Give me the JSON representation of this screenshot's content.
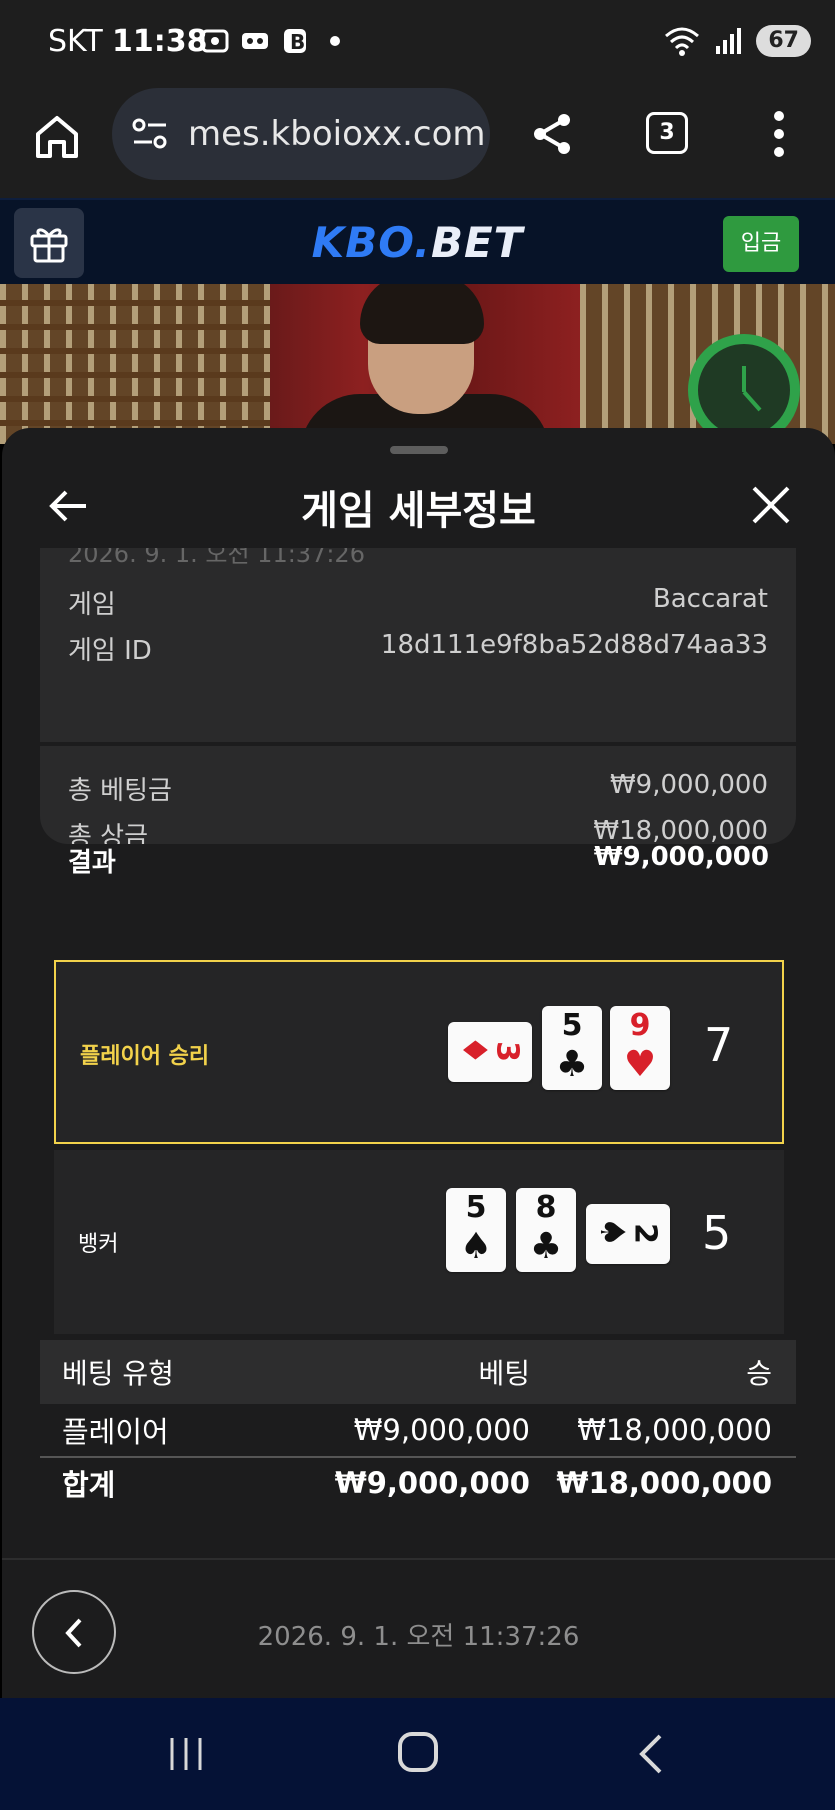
{
  "status_bar": {
    "carrier": "SKT",
    "time": "11:38",
    "battery": "67"
  },
  "browser": {
    "url": "mes.kboioxx.com",
    "tab_count": "3"
  },
  "site_header": {
    "logo_kbo": "KBO",
    "logo_dot": ".",
    "logo_bet": "BET",
    "deposit_label": "입금"
  },
  "sheet": {
    "title": "게임 세부정보",
    "faded_date": "2026. 9. 1. 오전 11:37:26",
    "info": [
      {
        "label": "게임",
        "value": "Baccarat"
      },
      {
        "label": "게임 ID",
        "value": "18d111e9f8ba52d88d74aa33"
      }
    ],
    "summary": [
      {
        "label": "총 베팅금",
        "value": "₩9,000,000"
      },
      {
        "label": "총 상금",
        "value": "₩18,000,000"
      },
      {
        "label": "결과",
        "value": "₩9,000,000"
      }
    ],
    "hands": [
      {
        "label": "플레이어 승리",
        "total": "7",
        "winner": true,
        "cards": [
          {
            "rank": "3",
            "suit": "♦",
            "color": "red",
            "sideways": true
          },
          {
            "rank": "5",
            "suit": "♣",
            "color": "black",
            "sideways": false
          },
          {
            "rank": "9",
            "suit": "♥",
            "color": "red",
            "sideways": false
          }
        ]
      },
      {
        "label": "뱅커",
        "total": "5",
        "winner": false,
        "cards": [
          {
            "rank": "5",
            "suit": "♠",
            "color": "black",
            "sideways": false
          },
          {
            "rank": "8",
            "suit": "♣",
            "color": "black",
            "sideways": false
          },
          {
            "rank": "2",
            "suit": "♠",
            "color": "black",
            "sideways": true
          }
        ]
      }
    ],
    "bet_table": {
      "headers": [
        "베팅 유형",
        "베팅",
        "승"
      ],
      "rows": [
        {
          "type": "플레이어",
          "bet": "₩9,000,000",
          "win": "₩18,000,000"
        }
      ],
      "total": {
        "type": "합계",
        "bet": "₩9,000,000",
        "win": "₩18,000,000"
      }
    },
    "footer_date": "2026. 9. 1. 오전 11:37:26"
  },
  "colors": {
    "accent_gold": "#f2d24b",
    "deposit_green": "#2f9a3f",
    "logo_blue": "#2f7bf5"
  }
}
